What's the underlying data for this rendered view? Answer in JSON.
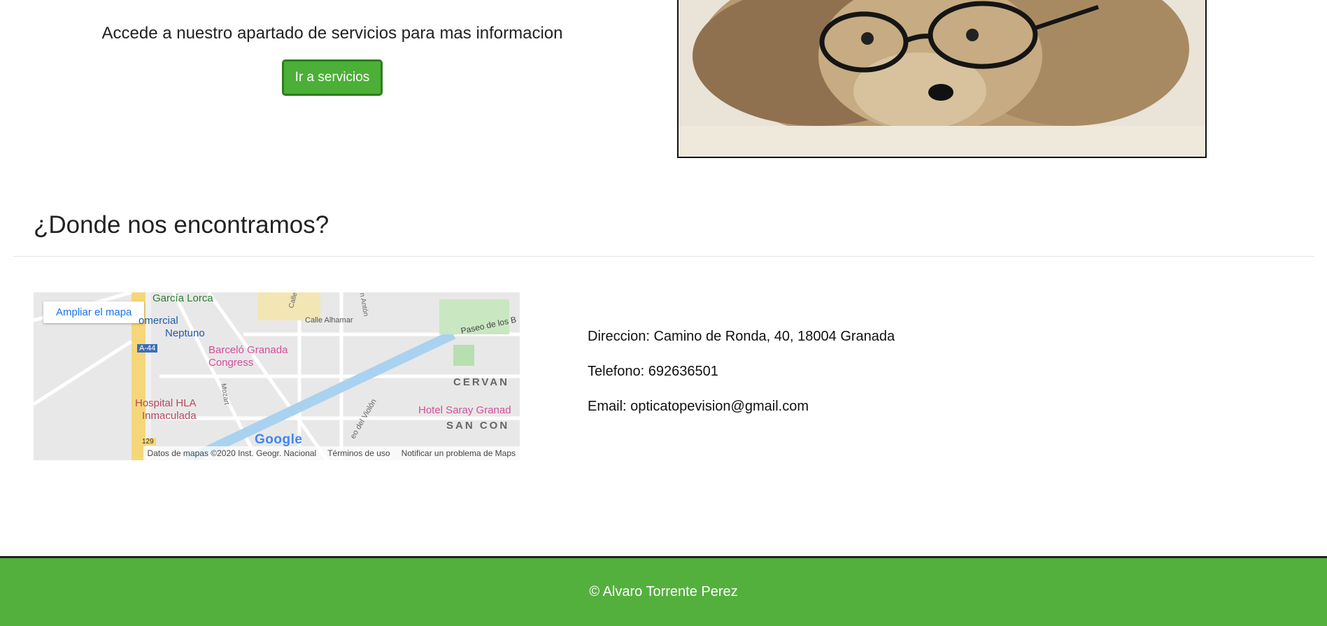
{
  "services": {
    "text": "Accede a nuestro apartado de servicios para mas informacion",
    "button_label": "Ir a servicios"
  },
  "location": {
    "title": "¿Donde nos encontramos?"
  },
  "map": {
    "expand_label": "Ampliar el mapa",
    "labels": [
      "García Lorca",
      "omercial",
      "Neptuno",
      "Barceló Granada",
      "Congress",
      "Calle Alhamar",
      "Paseo de los B",
      "CERVAN",
      "Hospital HLA",
      "Inmaculada",
      "Hotel Saray Granad",
      "SAN CON",
      "A-44",
      "129",
      "Mozart",
      "Calle",
      "n Antón",
      "eo del Violón"
    ],
    "logo": "Google",
    "footer": {
      "data": "Datos de mapas ©2020 Inst. Geogr. Nacional",
      "terms": "Términos de uso",
      "report": "Notificar un problema de Maps"
    }
  },
  "contact": {
    "address": "Direccion: Camino de Ronda, 40, 18004 Granada",
    "phone": "Telefono: 692636501",
    "email": "Email: opticatopevision@gmail.com"
  },
  "footer": {
    "copyright": "© Alvaro Torrente Perez"
  },
  "colors": {
    "accent_green": "#54b03d",
    "button_green": "#4caf37"
  }
}
